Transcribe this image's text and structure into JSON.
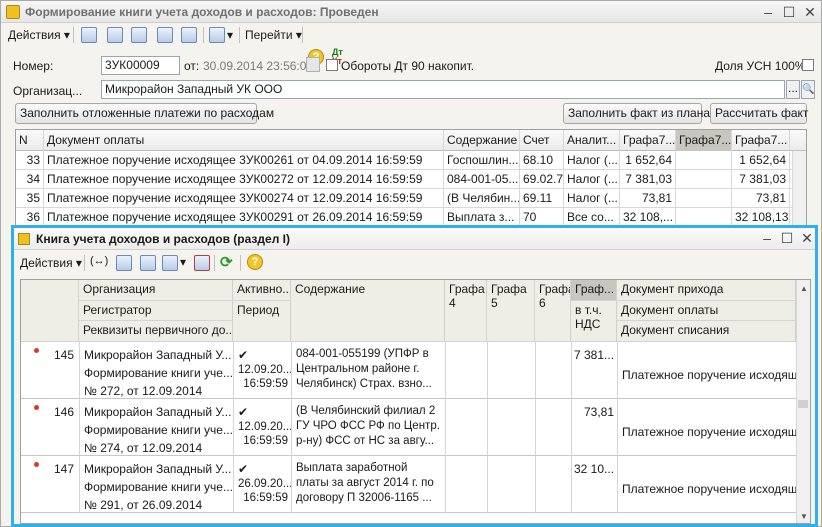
{
  "window": {
    "title": "Формирование книги учета доходов и расходов: Проведен"
  },
  "toolbar": {
    "actions_label": "Действия",
    "goto_label": "Перейти",
    "dtkt_label": "Дт Кт"
  },
  "header": {
    "number_label": "Номер:",
    "number_value": "3УК00009",
    "from_label": "от:",
    "date_value": "30.09.2014 23:56:00",
    "turnover_label": "Обороты Дт 90 накопит.",
    "usn_share_label": "Доля УСН 100%",
    "org_label": "Организац...",
    "org_value": "Микрорайон Западный УК ООО",
    "org_btn": "..."
  },
  "buttons": {
    "fill_deferred": "Заполнить отложенные платежи по расходам",
    "fill_fact": "Заполнить факт из плана",
    "calc_fact": "Рассчитать факт"
  },
  "grid1": {
    "headers": [
      "N",
      "Документ оплаты",
      "Содержание",
      "Счет",
      "Аналит...",
      "Графа7...",
      "Графа7...",
      "Графа7..."
    ],
    "rows": [
      {
        "n": "33",
        "doc": "Платежное поручение исходящее 3УК00261 от 04.09.2014 16:59:59",
        "content": "Госпошлин...",
        "account": "68.10",
        "analytic": "Налог (...",
        "g1": "1 652,64",
        "g2": "",
        "g3": "1 652,64"
      },
      {
        "n": "34",
        "doc": "Платежное поручение исходящее 3УК00272 от 12.09.2014 16:59:59",
        "content": "084-001-05...",
        "account": "69.02.7",
        "analytic": "Налог (...",
        "g1": "7 381,03",
        "g2": "",
        "g3": "7 381,03"
      },
      {
        "n": "35",
        "doc": "Платежное поручение исходящее 3УК00274 от 12.09.2014 16:59:59",
        "content": "(В Челябин...",
        "account": "69.11",
        "analytic": "Налог (...",
        "g1": "73,81",
        "g2": "",
        "g3": "73,81"
      },
      {
        "n": "36",
        "doc": "Платежное поручение исходящее 3УК00291 от 26.09.2014 16:59:59",
        "content": "Выплата з...",
        "account": "70",
        "analytic": "Все со...",
        "g1": "32 108,...",
        "g2": "",
        "g3": "32 108,13"
      }
    ]
  },
  "subwin": {
    "title": "Книга учета доходов и расходов  (раздел I)",
    "actions_label": "Действия",
    "hdr": {
      "org": "Организация",
      "registrar": "Регистратор",
      "requisites": "Реквизиты первичного до...",
      "active": "Активно...",
      "period": "Период",
      "content": "Содержание",
      "g4": "Графа 4",
      "g5": "Графа 5",
      "g6": "Графа 6",
      "graf": "Граф...",
      "incl": "в т.ч. НДС",
      "doc_income": "Документ прихода",
      "doc_payment": "Документ оплаты",
      "doc_writeoff": "Документ списания",
      "excl": "!"
    },
    "rows": [
      {
        "n": "145",
        "org": "Микрорайон Западный У...",
        "reg": "Формирование книги уче...",
        "req": "№ 272, от 12.09.2014",
        "check": "✔",
        "period": "12.09.20... 16:59:59",
        "content": "084-001-055199 (УПФР в Центральном районе г. Челябинск) Страх. взно...",
        "graf": "7 381...",
        "doc": "Платежное поручение исходящее"
      },
      {
        "n": "146",
        "org": "Микрорайон Западный У...",
        "reg": "Формирование книги уче...",
        "req": "№ 274, от 12.09.2014",
        "check": "✔",
        "period": "12.09.20... 16:59:59",
        "content": "(В Челябинский филиал 2 ГУ ЧРО ФСС РФ по Центр. р-ну) ФСС от НС за авгу...",
        "graf": "73,81",
        "doc": "Платежное поручение исходящее"
      },
      {
        "n": "147",
        "org": "Микрорайон Западный У...",
        "reg": "Формирование книги уче...",
        "req": "№ 291, от 26.09.2014",
        "check": "✔",
        "period": "26.09.20... 16:59:59",
        "content": "Выплата заработной платы за август 2014 г. по договору П 32006-1165 ...",
        "graf": "32 10...",
        "doc": "Платежное поручение исходящее"
      }
    ]
  },
  "colors": {
    "accent_border": "#2fb0e8",
    "row_marker": "#d23c2a"
  }
}
